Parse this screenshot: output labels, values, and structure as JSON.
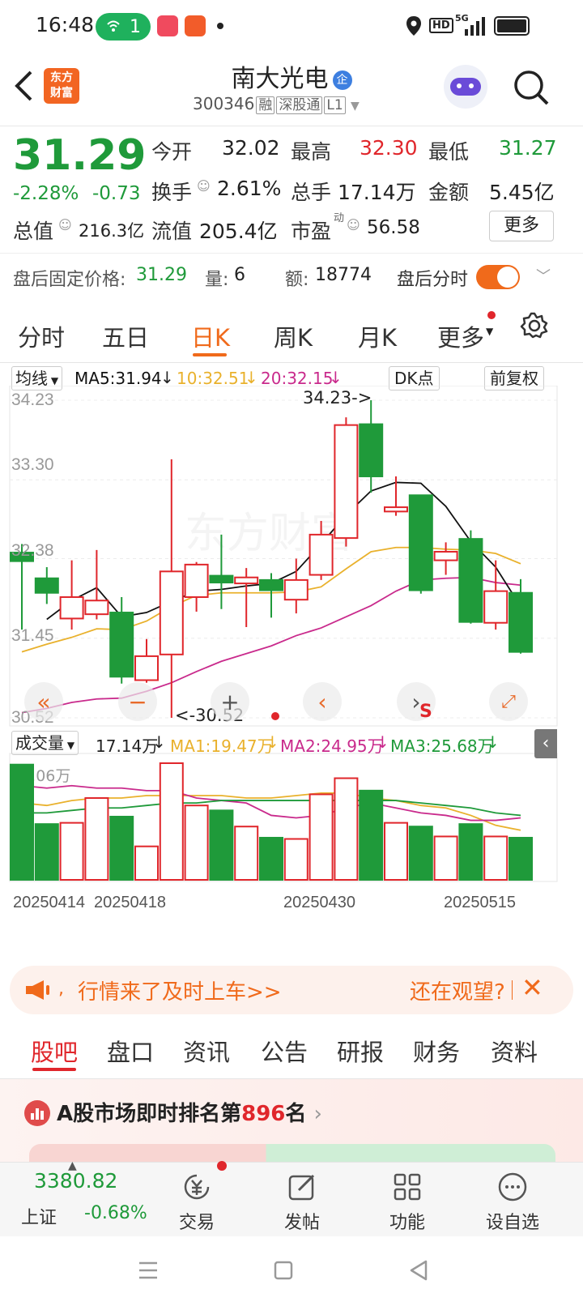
{
  "status": {
    "time": "16:48",
    "hotspot_count": "1",
    "hd": "HD",
    "net": "5G"
  },
  "header": {
    "app_logo": "东方\n财富",
    "stock_name": "南大光电",
    "ent_badge": "企",
    "code": "300346",
    "tags": [
      "融",
      "深股通",
      "L1"
    ]
  },
  "quote": {
    "price": "31.29",
    "change_pct": "-2.28%",
    "change": "-0.73",
    "open_label": "今开",
    "open": "32.02",
    "high_label": "最高",
    "high": "32.30",
    "low_label": "最低",
    "low": "31.27",
    "turnover_label": "换手",
    "turnover": "2.61%",
    "volume_label": "总手",
    "volume": "17.14万",
    "amount_label": "金额",
    "amount": "5.45亿",
    "mktcap_label": "总值",
    "mktcap": "216.3亿",
    "float_label": "流值",
    "float": "205.4亿",
    "pe_label": "市盈",
    "pe_sup": "动",
    "pe": "56.58",
    "more_label": "更多"
  },
  "afterhours": {
    "price_label": "盘后固定价格:",
    "price": "31.29",
    "vol_label": "量:",
    "vol": "6",
    "amt_label": "额:",
    "amt": "18774",
    "chart_label": "盘后分时"
  },
  "tabs": [
    "分时",
    "五日",
    "日K",
    "周K",
    "月K",
    "更多"
  ],
  "chart_opts": {
    "ma_select": "均线",
    "ma5": "MA5:31.94",
    "ma10": "10:32.51",
    "ma20": "20:32.15",
    "dk": "DK点",
    "adj": "前复权"
  },
  "price_axis": [
    "34.23",
    "33.30",
    "32.38",
    "31.45",
    "30.52"
  ],
  "annotations": {
    "max": "34.23->",
    "min": "<-30.52"
  },
  "vol_bar": {
    "select": "成交量",
    "vol": "17.14万",
    "ma1": "MA1:19.47万",
    "ma2": "MA2:24.95万",
    "ma3": "MA3:25.68万",
    "axis_max": "47.06万"
  },
  "dates": [
    "20250414",
    "20250418",
    "20250430",
    "20250515"
  ],
  "colors": {
    "up": "#e0262b",
    "down": "#1f9a3a",
    "ma5": "#111111",
    "ma10": "#e9b12c",
    "ma20": "#c92a8c",
    "accent": "#f06a1b"
  },
  "chart_data": {
    "type": "candlestick",
    "ylim": [
      30.52,
      34.23
    ],
    "candles": [
      {
        "o": 32.45,
        "h": 32.55,
        "l": 31.55,
        "c": 32.35
      },
      {
        "o": 32.15,
        "h": 32.28,
        "l": 31.85,
        "c": 31.98
      },
      {
        "o": 31.68,
        "h": 32.36,
        "l": 31.55,
        "c": 31.93
      },
      {
        "o": 31.73,
        "h": 32.48,
        "l": 31.67,
        "c": 31.89
      },
      {
        "o": 31.75,
        "h": 31.93,
        "l": 30.92,
        "c": 31.0
      },
      {
        "o": 30.96,
        "h": 31.44,
        "l": 30.93,
        "c": 31.24
      },
      {
        "o": 31.26,
        "h": 33.54,
        "l": 30.52,
        "c": 32.23
      },
      {
        "o": 31.93,
        "h": 32.34,
        "l": 31.76,
        "c": 32.31
      },
      {
        "o": 32.18,
        "h": 32.66,
        "l": 31.79,
        "c": 32.1
      },
      {
        "o": 32.09,
        "h": 32.27,
        "l": 31.58,
        "c": 32.16
      },
      {
        "o": 32.13,
        "h": 32.21,
        "l": 31.69,
        "c": 32.01
      },
      {
        "o": 31.9,
        "h": 32.38,
        "l": 31.74,
        "c": 32.13
      },
      {
        "o": 32.19,
        "h": 32.82,
        "l": 32.13,
        "c": 32.66
      },
      {
        "o": 32.62,
        "h": 34.03,
        "l": 32.52,
        "c": 33.94
      },
      {
        "o": 33.95,
        "h": 34.23,
        "l": 33.15,
        "c": 33.34
      },
      {
        "o": 32.93,
        "h": 33.34,
        "l": 32.88,
        "c": 32.98
      },
      {
        "o": 33.12,
        "h": 33.12,
        "l": 31.97,
        "c": 32.01
      },
      {
        "o": 32.36,
        "h": 32.57,
        "l": 32.19,
        "c": 32.46
      },
      {
        "o": 32.61,
        "h": 32.71,
        "l": 31.62,
        "c": 31.64
      },
      {
        "o": 31.63,
        "h": 32.36,
        "l": 31.55,
        "c": 32.0
      },
      {
        "o": 31.98,
        "h": 32.14,
        "l": 31.27,
        "c": 31.29
      }
    ],
    "ma5": [
      null,
      31.67,
      31.89,
      32.04,
      31.7,
      31.75,
      31.88,
      32.0,
      32.02,
      32.06,
      32.09,
      32.23,
      32.55,
      32.89,
      33.17,
      33.27,
      33.26,
      32.99,
      32.58,
      32.28,
      31.82
    ],
    "ma10": [
      31.29,
      31.38,
      31.46,
      31.56,
      31.55,
      31.65,
      31.82,
      31.95,
      31.98,
      31.98,
      31.98,
      31.99,
      32.05,
      32.26,
      32.46,
      32.51,
      32.51,
      32.49,
      32.48,
      32.44,
      32.32
    ],
    "ma20": [
      30.58,
      30.63,
      30.7,
      30.74,
      30.75,
      30.83,
      30.93,
      31.06,
      31.18,
      31.27,
      31.36,
      31.48,
      31.57,
      31.7,
      31.83,
      32.0,
      32.13,
      32.15,
      32.16,
      32.1,
      32.07
    ],
    "volume": [
      46.5,
      22.5,
      23.0,
      33.0,
      25.5,
      13.5,
      47.06,
      30.0,
      28.0,
      21.5,
      17.0,
      16.5,
      34.5,
      41.0,
      36.0,
      23.0,
      21.5,
      17.5,
      22.5,
      17.5,
      17.0
    ],
    "vol_ma1": [
      31,
      30,
      32,
      33,
      33,
      34,
      34,
      34,
      34,
      33,
      33,
      34,
      35,
      35,
      33,
      32,
      30,
      29,
      26,
      22,
      20
    ],
    "vol_ma2": [
      38,
      37,
      38,
      37,
      37,
      36,
      36,
      33,
      32,
      31,
      26,
      25,
      26,
      29,
      31,
      29,
      27,
      26,
      24,
      24,
      25
    ],
    "vol_ma3": [
      27,
      27,
      28,
      29,
      29,
      30,
      31,
      31,
      32,
      32,
      32,
      32,
      32,
      32,
      32,
      32,
      31,
      30,
      29,
      27,
      26
    ]
  },
  "banner": {
    "text": "行情来了及时上车>>",
    "action": "还在观望?"
  },
  "bottom_tabs": [
    "股吧",
    "盘口",
    "资讯",
    "公告",
    "研报",
    "财务",
    "资料"
  ],
  "ranking": {
    "prefix": "A股市场即时排名第",
    "rank": "896",
    "suffix": "名"
  },
  "dock": {
    "index_value": "3380.82",
    "index_name": "上证",
    "index_change": "-0.68%",
    "trade": "交易",
    "post": "发帖",
    "func": "功能",
    "watch": "设自选"
  }
}
